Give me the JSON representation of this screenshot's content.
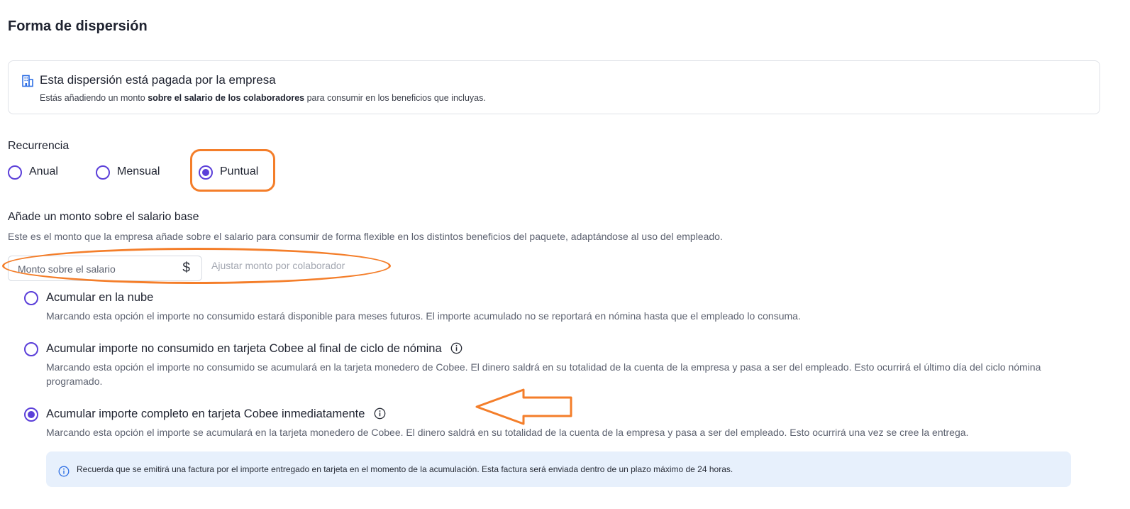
{
  "section": {
    "title": "Forma de dispersión"
  },
  "info": {
    "icon": "building-icon",
    "title": "Esta dispersión está pagada por la empresa",
    "desc_prefix": "Estás añadiendo un monto ",
    "desc_bold": "sobre el salario de los colaboradores",
    "desc_suffix": " para consumir en los beneficios que incluyas."
  },
  "recurrence": {
    "label": "Recurrencia",
    "options": [
      {
        "label": "Anual",
        "selected": false
      },
      {
        "label": "Mensual",
        "selected": false
      },
      {
        "label": "Puntual",
        "selected": true
      }
    ]
  },
  "amount": {
    "title": "Añade un monto sobre el salario base",
    "description": "Este es el monto que la empresa añade sobre el salario para consumir de forma flexible en los distintos beneficios del paquete, adaptándose al uso del empleado.",
    "input_placeholder": "Monto sobre el salario",
    "currency": "$",
    "adjust_link": "Ajustar monto por colaborador"
  },
  "accumulation": {
    "options": [
      {
        "title": "Acumular en la nube",
        "description": "Marcando esta opción el importe no consumido estará disponible para meses futuros. El importe acumulado no se reportará en nómina hasta que el empleado lo consuma.",
        "selected": false,
        "has_info_icon": false
      },
      {
        "title": "Acumular importe no consumido en tarjeta Cobee al final de ciclo de nómina",
        "description": "Marcando esta opción el importe no consumido se acumulará en la tarjeta monedero de Cobee. El dinero saldrá en su totalidad de la cuenta de la empresa y pasa a ser del empleado. Esto ocurrirá el último día del ciclo nómina programado.",
        "selected": false,
        "has_info_icon": true
      },
      {
        "title": "Acumular importe completo en tarjeta Cobee inmediatamente",
        "description": "Marcando esta opción el importe se acumulará en la tarjeta monedero de Cobee. El dinero saldrá en su totalidad de la cuenta de la empresa y pasa a ser del empleado. Esto ocurrirá una vez se cree la entrega.",
        "selected": true,
        "has_info_icon": true
      }
    ],
    "notice": "Recuerda que se emitirá una factura por el importe entregado en tarjeta en el momento de la acumulación. Esta factura será enviada dentro de un plazo máximo de 24 horas."
  },
  "colors": {
    "accent": "#5b3fd9",
    "annotation": "#f47e2a",
    "notice_bg": "#e7f0fc",
    "info_icon": "#2f6fe4"
  }
}
